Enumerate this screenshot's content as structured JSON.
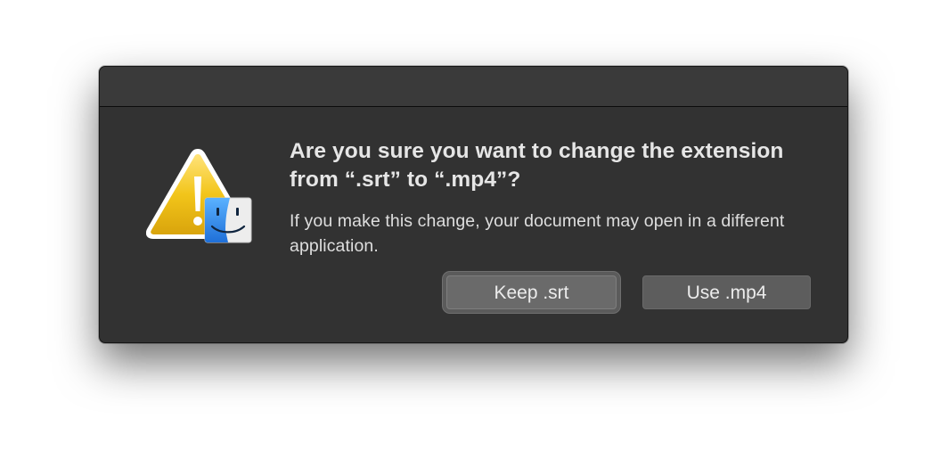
{
  "dialog": {
    "title": "Are you sure you want to change the extension from “.srt” to “.mp4”?",
    "message": "If you make this change, your document may open in a different application.",
    "buttons": {
      "keep_label": "Keep .srt",
      "use_label": "Use .mp4"
    },
    "icons": {
      "alert": "warning-triangle-icon",
      "app": "finder-icon"
    },
    "colors": {
      "background": "#323232",
      "titlebar": "#3a3a3a",
      "warning_yellow": "#f2c51a",
      "finder_blue": "#2f7fe0"
    }
  }
}
